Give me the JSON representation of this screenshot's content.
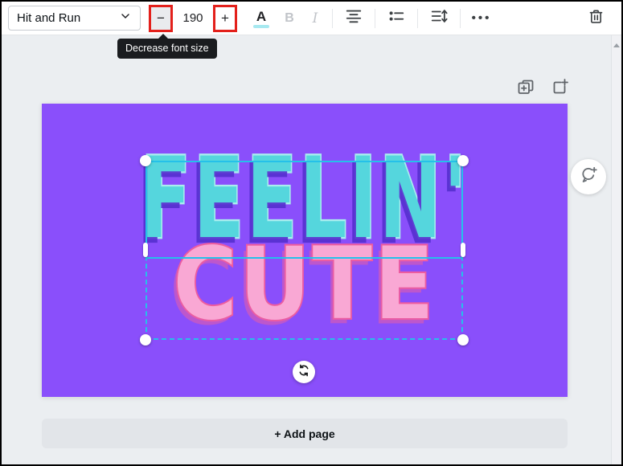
{
  "toolbar": {
    "font_selector": {
      "value": "Hit and Run"
    },
    "font_size": {
      "value": "190",
      "decrease_label": "−",
      "increase_label": "+"
    },
    "text_color": {
      "label": "A"
    },
    "bold": {
      "label": "B"
    },
    "italic": {
      "label": "I"
    },
    "more": {
      "label": "•••"
    }
  },
  "tooltip": {
    "text": "Decrease font size"
  },
  "canvas": {
    "text_line1": "FEELIN'",
    "text_line2": "CUTE"
  },
  "footer": {
    "add_page_label": "+ Add page"
  },
  "colors": {
    "annotation_highlight": "#E3201B",
    "selection": "#25C1E9",
    "canvas_background": "#8A4FFB",
    "line1_fill": "#55D6DD",
    "line1_outline": "#A9EDEE",
    "line2_fill": "#F9A8D4",
    "line2_outline": "#EE5C9F",
    "text_color_swatch": "#A7E9F0",
    "tooltip_background": "#1A1C1F"
  }
}
